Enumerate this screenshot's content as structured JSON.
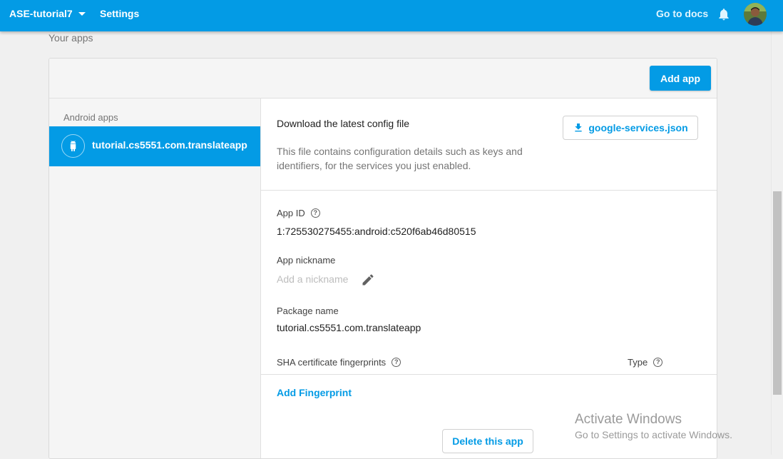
{
  "topbar": {
    "project_name": "ASE-tutorial7",
    "section": "Settings",
    "docs_link": "Go to docs",
    "icons": [
      "chevron-down-icon",
      "bell-icon",
      "avatar"
    ]
  },
  "section_title": "Your apps",
  "card": {
    "add_app_label": "Add app",
    "sidebar": {
      "title": "Android apps",
      "items": [
        {
          "label": "tutorial.cs5551.com.translateapp",
          "icon": "android-icon",
          "selected": true
        }
      ]
    },
    "detail": {
      "config_title": "Download the latest config file",
      "config_description": "This file contains configuration details such as keys and identifiers, for the services you just enabled.",
      "config_button": "google-services.json",
      "app_id_label": "App ID",
      "app_id_value": "1:725530275455:android:c520f6ab46d80515",
      "nickname_label": "App nickname",
      "nickname_placeholder": "Add a nickname",
      "package_label": "Package name",
      "package_value": "tutorial.cs5551.com.translateapp",
      "sha_label": "SHA certificate fingerprints",
      "type_label": "Type",
      "add_fingerprint": "Add Fingerprint",
      "delete_app": "Delete this app"
    }
  },
  "watermark": {
    "title": "Activate Windows",
    "subtitle": "Go to Settings to activate Windows."
  },
  "colors": {
    "accent": "#039be5",
    "page_background": "#f0f0f0",
    "muted_text": "#757575"
  }
}
